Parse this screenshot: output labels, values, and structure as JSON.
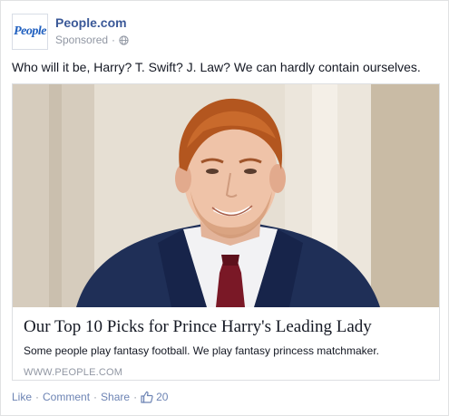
{
  "post": {
    "page_name": "People.com",
    "avatar_text": "People",
    "sponsored_label": "Sponsored",
    "meta_separator": "·",
    "message": "Who will it be, Harry? T. Swift? J. Law? We can hardly contain ourselves."
  },
  "attachment": {
    "title": "Our Top 10 Picks for Prince Harry's Leading Lady",
    "description": "Some people play fantasy football. We play fantasy princess matchmaker.",
    "domain": "WWW.PEOPLE.COM"
  },
  "actions": {
    "like": "Like",
    "comment": "Comment",
    "share": "Share",
    "separator": "·",
    "like_count": "20"
  },
  "colors": {
    "link_blue": "#3b5998",
    "action_blue": "#6d84b4",
    "meta_gray": "#9197a3",
    "suit_navy": "#1f2f57",
    "tie_red": "#7a1826"
  },
  "icons": {
    "privacy": "globe-icon",
    "likes": "thumbs-up-icon"
  }
}
